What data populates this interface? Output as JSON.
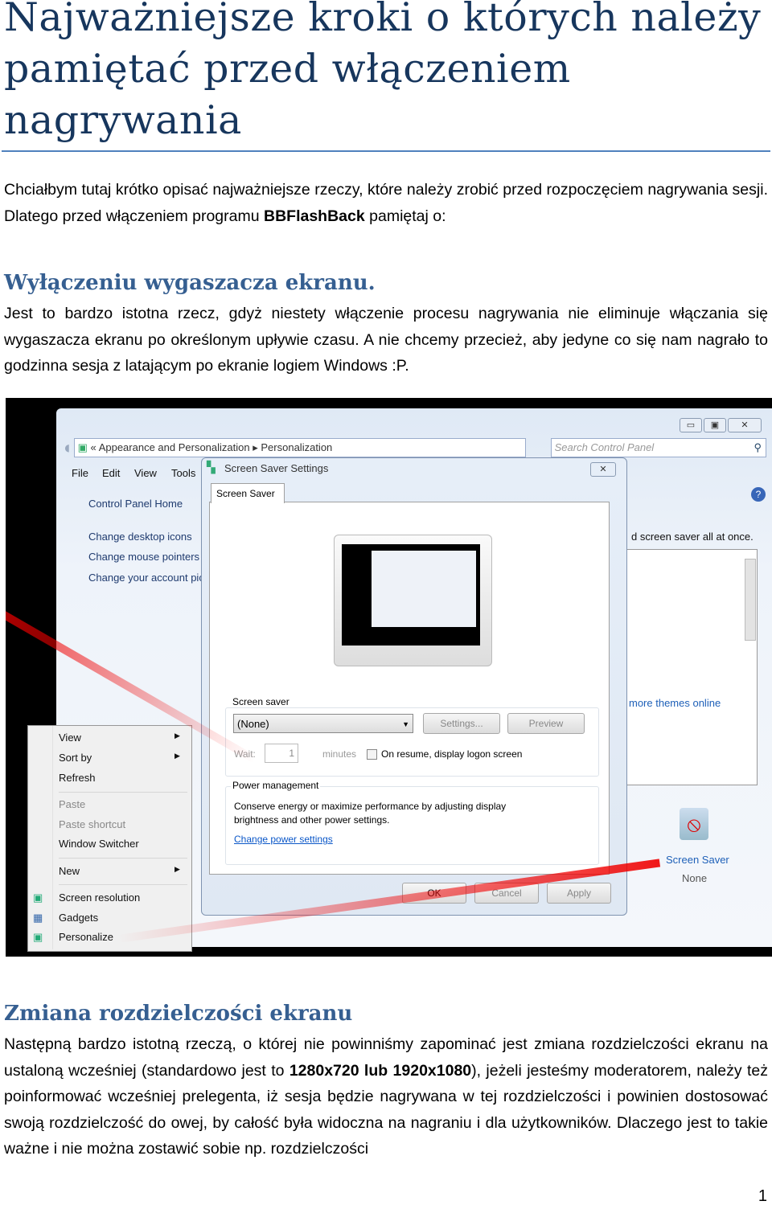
{
  "title": "Najważniejsze kroki o których należy pamiętać przed włączeniem nagrywania",
  "intro": {
    "text1": "Chciałbym tutaj krótko opisać najważniejsze rzeczy, które należy zrobić przed rozpoczęciem nagrywania sesji. Dlatego przed włączeniem programu ",
    "bold": "BBFlashBack",
    "text2": " pamiętaj o:"
  },
  "section1": {
    "heading": "Wyłączeniu wygaszacza ekranu.",
    "text": "Jest to bardzo istotna rzecz, gdyż niestety włączenie procesu nagrywania nie eliminuje włączania się wygaszacza ekranu po określonym upływie czasu. A nie chcemy przecież, aby jedyne co się nam nagrało to godzinna sesja z latającym po ekranie logiem Windows :P."
  },
  "screenshot": {
    "breadcrumb": [
      "«",
      "Appearance and Personalization",
      "▸",
      "Personalization"
    ],
    "search_placeholder": "Search Control Panel",
    "menu": [
      "File",
      "Edit",
      "View",
      "Tools"
    ],
    "sidebar": [
      "Control Panel Home",
      "Change desktop icons",
      "Change mouse pointers",
      "Change your account picture"
    ],
    "right_text": "d screen saver all at once.",
    "more_themes": "more themes online",
    "screen_saver_item": {
      "label": "Screen Saver",
      "value": "None"
    },
    "dialog": {
      "title": "Screen Saver Settings",
      "tab": "Screen Saver",
      "group1": "Screen saver",
      "selected": "(None)",
      "settings": "Settings...",
      "preview": "Preview",
      "wait": "Wait:",
      "wait_value": "1",
      "minutes": "minutes",
      "resume": "On resume, display logon screen",
      "group2": "Power management",
      "power_text": "Conserve energy or maximize performance by adjusting display brightness and other power settings.",
      "power_link": "Change power settings",
      "ok": "OK",
      "cancel": "Cancel",
      "apply": "Apply"
    },
    "context_menu": {
      "view": "View",
      "sort_by": "Sort by",
      "refresh": "Refresh",
      "paste": "Paste",
      "paste_shortcut": "Paste shortcut",
      "window_switcher": "Window Switcher",
      "new": "New",
      "screen_resolution": "Screen resolution",
      "gadgets": "Gadgets",
      "personalize": "Personalize"
    }
  },
  "section2": {
    "heading": "Zmiana rozdzielczości ekranu",
    "text1": "Następną bardzo istotną rzeczą, o której nie powinniśmy zapominać jest zmiana rozdzielczości ekranu na ustaloną wcześniej (standardowo jest to ",
    "bold": "1280x720 lub 1920x1080",
    "text2": "), jeżeli jesteśmy moderatorem, należy też poinformować wcześniej prelegenta, iż sesja będzie nagrywana w tej rozdzielczości i powinien dostosować swoją rozdzielczość do owej, by całość była widoczna na nagraniu i dla użytkowników. Dlaczego jest to takie ważne i nie można zostawić sobie np. rozdzielczości"
  },
  "page_number": "1"
}
